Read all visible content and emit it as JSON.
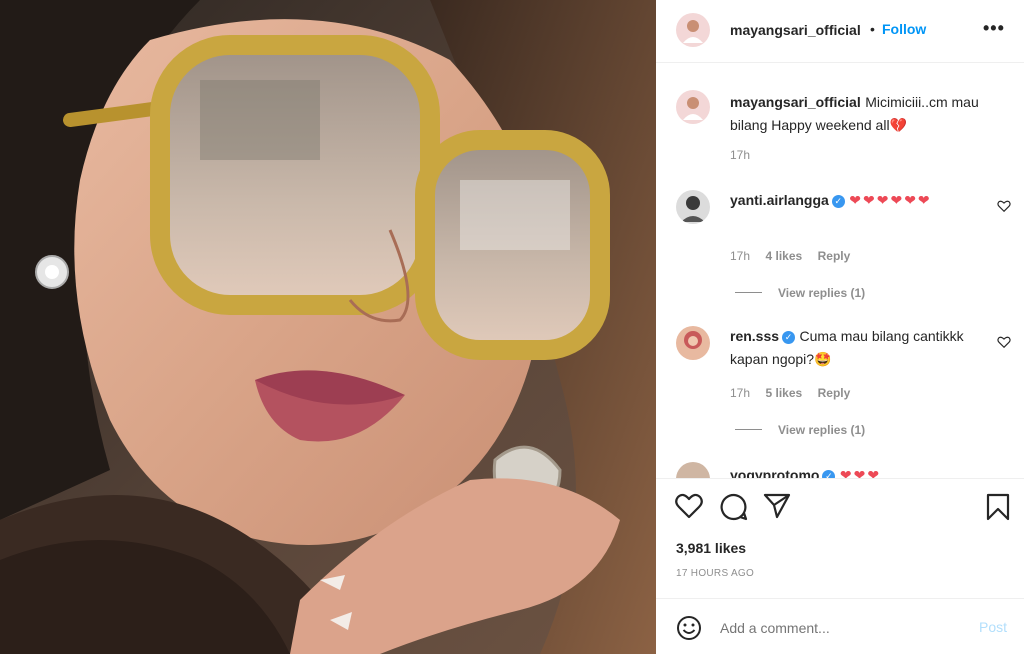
{
  "post": {
    "username": "mayangsari_official",
    "follow_label": "Follow",
    "separator": "•",
    "more_icon": "more-horizontal-icon"
  },
  "caption": {
    "username": "mayangsari_official",
    "text": "Micimiciii..cm mau bilang Happy weekend all💔",
    "time": "17h"
  },
  "comments": [
    {
      "username": "yanti.airlangga",
      "text": "❤❤❤❤❤❤",
      "time": "17h",
      "likes": "4 likes",
      "reply": "Reply",
      "view_replies": "View replies (1)"
    },
    {
      "username": "ren.sss",
      "text": "Cuma mau bilang cantikkk kapan ngopi?🤩",
      "time": "17h",
      "likes": "5 likes",
      "reply": "Reply",
      "view_replies": "View replies (1)"
    },
    {
      "username": "yogyprotomo",
      "text": "❤❤❤"
    }
  ],
  "stats": {
    "likes": "3,981 likes",
    "posted": "17 HOURS AGO"
  },
  "composer": {
    "placeholder": "Add a comment...",
    "post_label": "Post"
  },
  "colors": {
    "link_blue": "#0095f6",
    "verified": "#3897f0",
    "heart_red": "#ed4956",
    "muted": "#8e8e8e"
  }
}
